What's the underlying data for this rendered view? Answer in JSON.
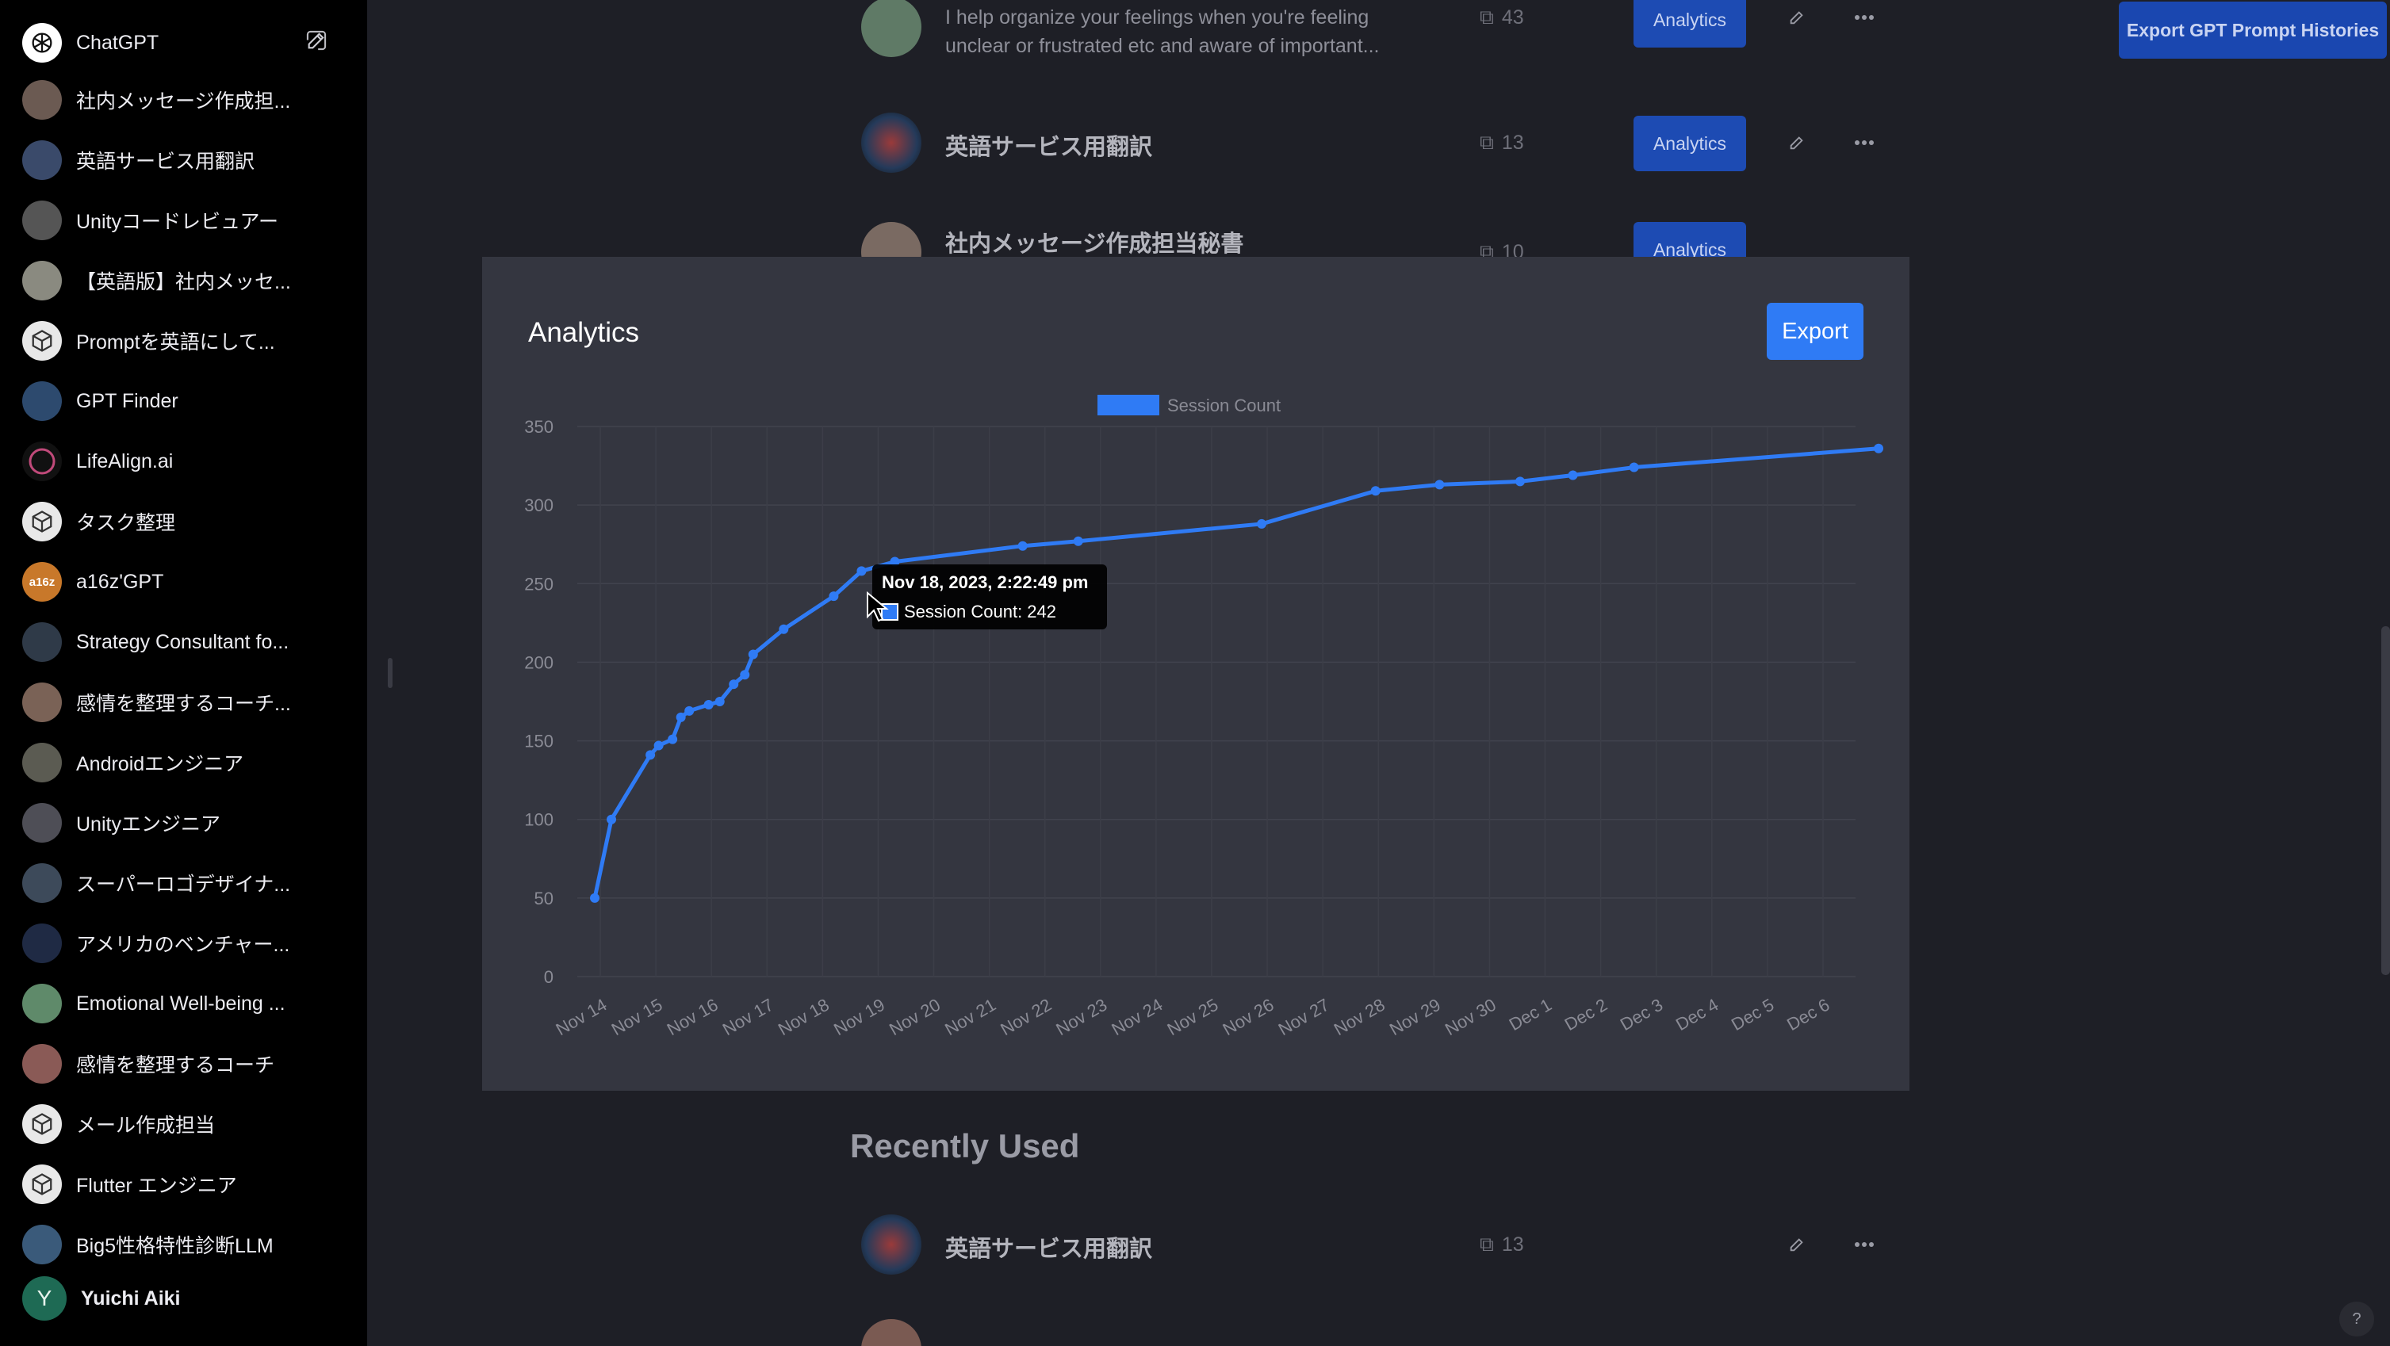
{
  "sidebar": {
    "items": [
      {
        "label": "ChatGPT",
        "icon": "chatgpt-logo-icon",
        "avatar_color": "#ffffff"
      },
      {
        "label": "社内メッセージ作成担...",
        "icon": "person-avatar-icon",
        "avatar_color": "#6b5a52"
      },
      {
        "label": "英語サービス用翻訳",
        "icon": "swirl-avatar-icon",
        "avatar_color": "#3a4a6a"
      },
      {
        "label": "Unityコードレビュアー",
        "icon": "unity-avatar-icon",
        "avatar_color": "#555555"
      },
      {
        "label": "【英語版】社内メッセ...",
        "icon": "person-avatar-icon",
        "avatar_color": "#8a8a80"
      },
      {
        "label": "Promptを英語にして...",
        "icon": "cube-icon",
        "avatar_color": "#e8e8e8"
      },
      {
        "label": "GPT Finder",
        "icon": "globe-avatar-icon",
        "avatar_color": "#2d4a6e"
      },
      {
        "label": "LifeAlign.ai",
        "icon": "ring-avatar-icon",
        "avatar_color": "#111111"
      },
      {
        "label": "タスク整理",
        "icon": "cube-icon",
        "avatar_color": "#e8e8e8"
      },
      {
        "label": "a16z'GPT",
        "icon": "a16z-logo-icon",
        "avatar_color": "#c8782a"
      },
      {
        "label": "Strategy Consultant fo...",
        "icon": "person-avatar-icon",
        "avatar_color": "#2f3a48"
      },
      {
        "label": "感情を整理するコーチ...",
        "icon": "person-avatar-icon",
        "avatar_color": "#7a6256"
      },
      {
        "label": "Androidエンジニア",
        "icon": "person-avatar-icon",
        "avatar_color": "#5b5b52"
      },
      {
        "label": "Unityエンジニア",
        "icon": "person-avatar-icon",
        "avatar_color": "#4e4e56"
      },
      {
        "label": "スーパーロゴデザイナ...",
        "icon": "logo-avatar-icon",
        "avatar_color": "#3d4a5a"
      },
      {
        "label": "アメリカのベンチャー...",
        "icon": "emblem-avatar-icon",
        "avatar_color": "#1f2a44"
      },
      {
        "label": "Emotional Well-being ...",
        "icon": "wellbeing-avatar-icon",
        "avatar_color": "#5f8a6a"
      },
      {
        "label": "感情を整理するコーチ",
        "icon": "person-avatar-icon",
        "avatar_color": "#8a5a56"
      },
      {
        "label": "メール作成担当",
        "icon": "cube-icon",
        "avatar_color": "#e8e8e8"
      },
      {
        "label": "Flutter エンジニア",
        "icon": "cube-icon",
        "avatar_color": "#e8e8e8"
      },
      {
        "label": "Big5性格特性診断LLM",
        "icon": "brain-avatar-icon",
        "avatar_color": "#3a5a7a"
      }
    ],
    "user": {
      "name": "Yuichi Aiki",
      "initial": "Y",
      "avatar_color": "#1e6a54"
    }
  },
  "header": {
    "export_histories_label": "Export GPT Prompt Histories"
  },
  "list": {
    "rows": [
      {
        "title": "",
        "desc": "I help organize your feelings when you're feeling unclear or frustrated etc and aware of important...",
        "count": "43",
        "analytics_label": "Analytics"
      },
      {
        "title": "英語サービス用翻訳",
        "count": "13",
        "analytics_label": "Analytics"
      },
      {
        "title": "社内メッセージ作成担当秘書",
        "count": "10",
        "analytics_label": "Analytics"
      }
    ],
    "recently_used_heading": "Recently Used",
    "recent_rows": [
      {
        "title": "英語サービス用翻訳",
        "count": "13"
      }
    ]
  },
  "modal": {
    "title": "Analytics",
    "export_label": "Export",
    "tooltip": {
      "title": "Nov 18, 2023, 2:22:49 pm",
      "label": "Session Count: 242"
    }
  },
  "help_label": "?",
  "colors": {
    "accent": "#2f7bf5",
    "line": "#2f7bf5",
    "modal_bg": "#343640",
    "sidebar_bg": "#000000"
  },
  "chart_data": {
    "type": "line",
    "legend": [
      "Session Count"
    ],
    "legend_position": "top-center",
    "grid": true,
    "ylim": [
      0,
      350
    ],
    "yticks": [
      0,
      50,
      100,
      150,
      200,
      250,
      300,
      350
    ],
    "xtick_labels": [
      "Nov 14",
      "Nov 15",
      "Nov 16",
      "Nov 17",
      "Nov 18",
      "Nov 19",
      "Nov 20",
      "Nov 21",
      "Nov 22",
      "Nov 23",
      "Nov 24",
      "Nov 25",
      "Nov 26",
      "Nov 27",
      "Nov 28",
      "Nov 29",
      "Nov 30",
      "Dec 1",
      "Dec 2",
      "Dec 3",
      "Dec 4",
      "Dec 5",
      "Dec 6"
    ],
    "series": [
      {
        "name": "Session Count",
        "x_days_from_nov14": [
          -0.1,
          0.2,
          0.9,
          1.05,
          1.3,
          1.45,
          1.6,
          1.95,
          2.15,
          2.4,
          2.6,
          2.75,
          3.3,
          4.2,
          4.7,
          5.3,
          7.6,
          8.6,
          11.9,
          13.95,
          15.1,
          16.55,
          17.5,
          18.6,
          23.0
        ],
        "values": [
          50,
          100,
          141,
          147,
          151,
          165,
          169,
          173,
          175,
          186,
          192,
          205,
          221,
          242,
          258,
          264,
          274,
          277,
          288,
          309,
          313,
          315,
          319,
          324,
          336
        ]
      }
    ]
  }
}
